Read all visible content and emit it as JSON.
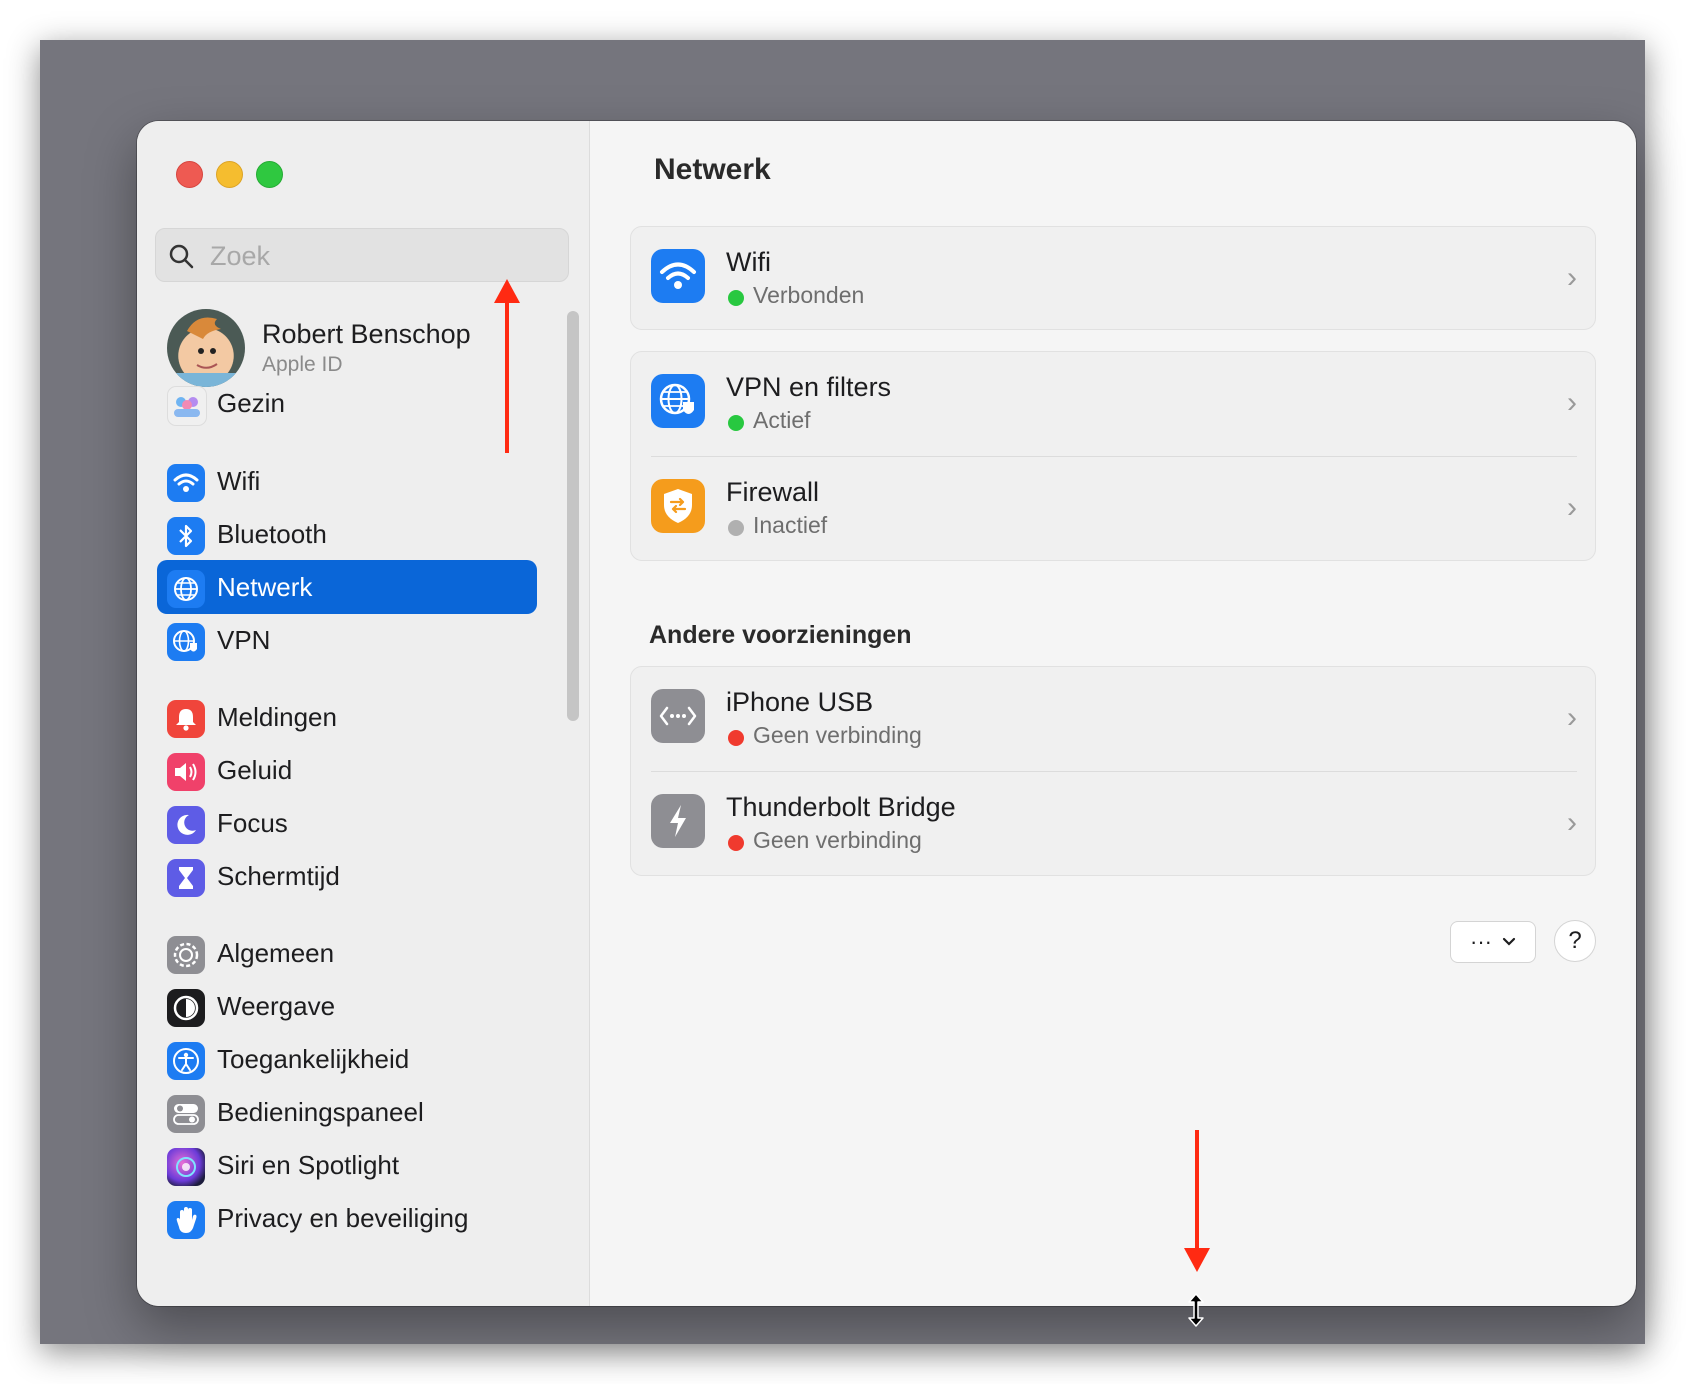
{
  "search": {
    "placeholder": "Zoek"
  },
  "profile": {
    "name": "Robert Benschop",
    "subtitle": "Apple ID"
  },
  "sidebar": {
    "items": [
      {
        "label": "Gezin",
        "icon": "family-icon"
      },
      {
        "label": "Wifi",
        "icon": "wifi-icon"
      },
      {
        "label": "Bluetooth",
        "icon": "bluetooth-icon"
      },
      {
        "label": "Netwerk",
        "icon": "network-globe-icon",
        "selected": true
      },
      {
        "label": "VPN",
        "icon": "vpn-globe-icon"
      },
      {
        "label": "Meldingen",
        "icon": "bell-icon"
      },
      {
        "label": "Geluid",
        "icon": "speaker-icon"
      },
      {
        "label": "Focus",
        "icon": "moon-icon"
      },
      {
        "label": "Schermtijd",
        "icon": "hourglass-icon"
      },
      {
        "label": "Algemeen",
        "icon": "gear-icon"
      },
      {
        "label": "Weergave",
        "icon": "display-icon"
      },
      {
        "label": "Toegankelijkheid",
        "icon": "accessibility-icon"
      },
      {
        "label": "Bedieningspaneel",
        "icon": "control-center-icon"
      },
      {
        "label": "Siri en Spotlight",
        "icon": "siri-icon"
      },
      {
        "label": "Privacy en beveiliging",
        "icon": "hand-icon"
      }
    ]
  },
  "main": {
    "title": "Netwerk",
    "services": [
      {
        "name": "Wifi",
        "status": "Verbonden",
        "status_color": "#28c840",
        "icon": "wifi-icon"
      },
      {
        "name": "VPN en filters",
        "status": "Actief",
        "status_color": "#28c840",
        "icon": "vpn-globe-icon"
      },
      {
        "name": "Firewall",
        "status": "Inactief",
        "status_color": "#b0b0b0",
        "icon": "firewall-shield-icon"
      }
    ],
    "other_section_title": "Andere voorzieningen",
    "other": [
      {
        "name": "iPhone USB",
        "status": "Geen verbinding",
        "status_color": "#f03a2e",
        "icon": "usb-ethernet-icon"
      },
      {
        "name": "Thunderbolt Bridge",
        "status": "Geen verbinding",
        "status_color": "#f03a2e",
        "icon": "thunderbolt-icon"
      }
    ],
    "more_button": "···",
    "help_button": "?"
  },
  "colors": {
    "accent": "#0a66d8",
    "annotation_arrow": "#ff2a12"
  }
}
